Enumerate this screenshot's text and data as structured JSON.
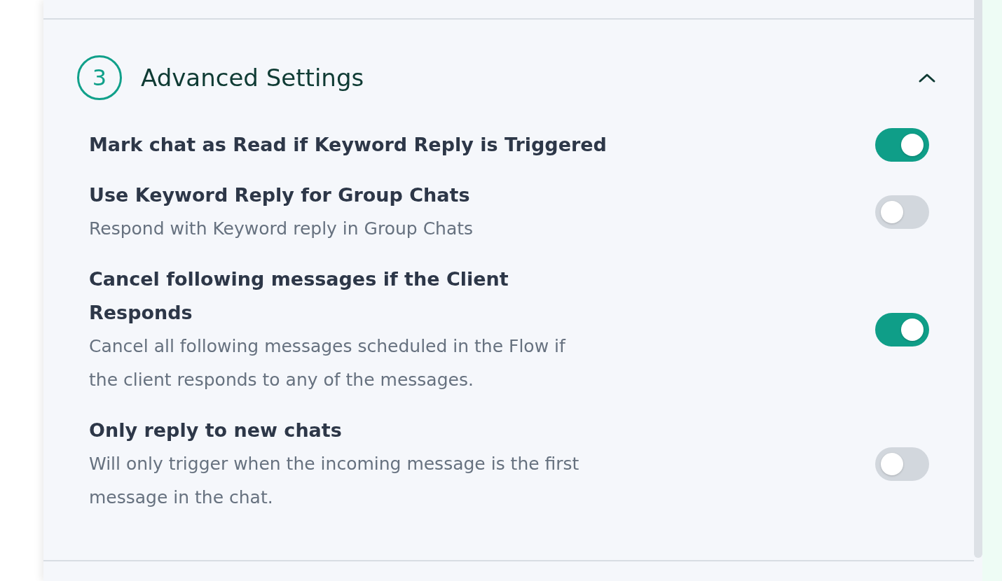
{
  "section": {
    "number": "3",
    "title": "Advanced Settings",
    "expanded": true
  },
  "settings": [
    {
      "label": "Mark chat as Read if Keyword Reply is Triggered",
      "on": true
    },
    {
      "label": "Use Keyword Reply for Group Chats",
      "description": "Respond with Keyword reply in Group Chats",
      "on": false
    },
    {
      "label": "Cancel following messages if the Client Responds",
      "description": "Cancel all following messages scheduled in the Flow if the client responds to any of the messages.",
      "on": true
    },
    {
      "label": "Only reply to new chats",
      "description": "Will only trigger when the incoming message is the first message in the chat.",
      "on": false
    }
  ]
}
